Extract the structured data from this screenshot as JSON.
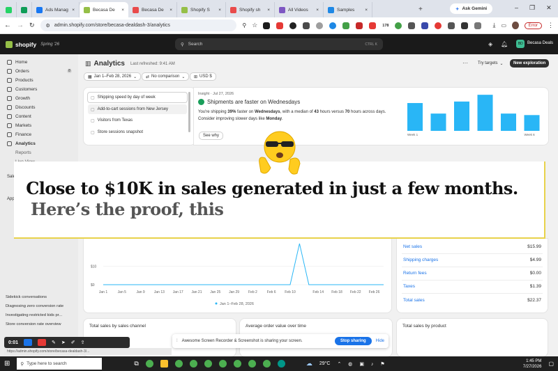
{
  "browser": {
    "tabs": [
      {
        "label": "",
        "color": "#25d366"
      },
      {
        "label": "",
        "color": "#0f9d58"
      },
      {
        "label": "Ads Manag",
        "color": "#1877f2"
      },
      {
        "label": "Becasa De",
        "color": "#95bf47",
        "active": true
      },
      {
        "label": "Becasa De",
        "color": "#e94b4b"
      },
      {
        "label": "Shopify S",
        "color": "#95bf47"
      },
      {
        "label": "Shopify sh",
        "color": "#e94b4b"
      },
      {
        "label": "All Videos",
        "color": "#7e57c2"
      },
      {
        "label": "Samples",
        "color": "#1e88e5"
      }
    ],
    "new_tab": "+",
    "ask_gemini": "Ask Gemini",
    "url": "admin.shopify.com/store/becasa-dealdash-3/analytics",
    "error_label": "Error",
    "ext_badge": "178"
  },
  "shopify": {
    "logo": "shopify",
    "edition": "Spring '26",
    "search_placeholder": "Search",
    "search_shortcut": "CTRL   K",
    "store_name": "Becasa Deals",
    "store_initials": "BD"
  },
  "sidebar": {
    "items": [
      {
        "label": "Home",
        "badge": ""
      },
      {
        "label": "Orders",
        "badge": "8"
      },
      {
        "label": "Products",
        "badge": ""
      },
      {
        "label": "Customers",
        "badge": ""
      },
      {
        "label": "Growth",
        "badge": ""
      },
      {
        "label": "Discounts",
        "badge": ""
      },
      {
        "label": "Content",
        "badge": ""
      },
      {
        "label": "Markets",
        "badge": ""
      },
      {
        "label": "Finance",
        "badge": ""
      },
      {
        "label": "Analytics",
        "badge": "",
        "active": true
      },
      {
        "label": "Reports",
        "badge": ""
      },
      {
        "label": "Live View",
        "badge": ""
      }
    ],
    "partial_sales": "Sale",
    "partial_apps": "App",
    "lower_links": [
      "Sidekick conversations",
      "Diagnosing zero conversion rate",
      "Investigating restricted kids pr...",
      "Store conversion rate overview"
    ]
  },
  "analytics": {
    "title": "Analytics",
    "last_refreshed": "Last refreshed: 9:41 AM",
    "date_range": "Jan 1–Feb 28, 2026",
    "comparison": "No comparison",
    "currency": "USD $",
    "more": "···",
    "try_targets": "Try targets",
    "new_exploration": "New exploration",
    "suggestions": [
      "Shipping speed by day of week",
      "Add-to-cart sessions from New Jersey",
      "Visitors from Texas",
      "Store sessions snapshot"
    ],
    "insight": {
      "meta": "Insight · Jul 27, 2026",
      "title": "Shipments are faster on Wednesdays",
      "text_1": "You're shipping ",
      "pct": "39%",
      "text_2": " faster on ",
      "day": "Wednesdays",
      "text_3": ", with a median of ",
      "h1": "43",
      "text_4": " hours versus ",
      "h2": "70",
      "text_5": " hours across days. Consider improving slower days like ",
      "slow_day": "Monday",
      "text_6": ".",
      "see_why": "See why"
    }
  },
  "chart_data": [
    {
      "type": "bar",
      "categories": [
        "Week 1",
        "",
        "",
        "",
        "",
        "Week 6"
      ],
      "values": [
        37,
        23,
        39,
        48,
        23,
        21
      ],
      "tick_labels": [
        "Week 1",
        "Week 6"
      ],
      "ylim": [
        0,
        50
      ],
      "color": "#29b6f6"
    },
    {
      "type": "line",
      "x": [
        "Jan 1",
        "Jan 3",
        "Jan 5",
        "Jan 7",
        "Jan 9",
        "Jan 11",
        "Jan 13",
        "Jan 15",
        "Jan 17",
        "Jan 19",
        "Jan 21",
        "Jan 23",
        "Jan 25",
        "Jan 27",
        "Jan 29",
        "Jan 31",
        "Feb 2",
        "Feb 4",
        "Feb 6",
        "Feb 8",
        "Feb 10",
        "Feb 11",
        "Feb 12",
        "Feb 14",
        "Feb 16",
        "Feb 18",
        "Feb 20",
        "Feb 22",
        "Feb 24",
        "Feb 26",
        "Feb 28"
      ],
      "series": [
        {
          "name": "Jan 1–Feb 28, 2026",
          "values": [
            0,
            0,
            0,
            0,
            0,
            0,
            0,
            0,
            0,
            0,
            0,
            0,
            0,
            0,
            0,
            0,
            0,
            0,
            0,
            0,
            0,
            22.37,
            0,
            0,
            0,
            0,
            0,
            0,
            0,
            0,
            0
          ]
        }
      ],
      "tick_labels": [
        "Jan 1",
        "Jan 5",
        "Jan 9",
        "Jan 13",
        "Jan 17",
        "Jan 21",
        "Jan 25",
        "Jan 29",
        "Feb 2",
        "Feb 6",
        "Feb 10",
        "Feb 14",
        "Feb 18",
        "Feb 22",
        "Feb 26"
      ],
      "y_ticks": [
        "$10",
        "$0"
      ],
      "ylim": [
        0,
        25
      ],
      "color": "#29b6f6"
    }
  ],
  "breakdown": [
    {
      "label": "Net sales",
      "value": "$15.99"
    },
    {
      "label": "Shipping charges",
      "value": "$4.99"
    },
    {
      "label": "Return fees",
      "value": "$0.00"
    },
    {
      "label": "Taxes",
      "value": "$1.39"
    },
    {
      "label": "Total sales",
      "value": "$22.37"
    }
  ],
  "bottom_cards": {
    "channel": "Total sales by sales channel",
    "aov": "Average order value over time",
    "product": "Total sales by product"
  },
  "overlay": {
    "line1": "Close to $10K in sales generated in just a few months.",
    "line2": "Here’s the proof, this"
  },
  "recorder": {
    "time": "0:01",
    "share_msg": "Awesome Screen Recorder & Screenshot is sharing your screen.",
    "stop": "Stop sharing",
    "hide": "Hide",
    "status_url": "https://admin.shopify.com/store/becasa-dealdash-3/..."
  },
  "taskbar": {
    "search_placeholder": "Type here to search",
    "temp": "29°C",
    "time": "1:45 PM",
    "date": "7/27/2026"
  },
  "colors": {
    "accent": "#29b6f6",
    "shopify_dark": "#1a1a1a",
    "highlight": "#e8d24a",
    "stop_btn": "#1a73e8"
  }
}
